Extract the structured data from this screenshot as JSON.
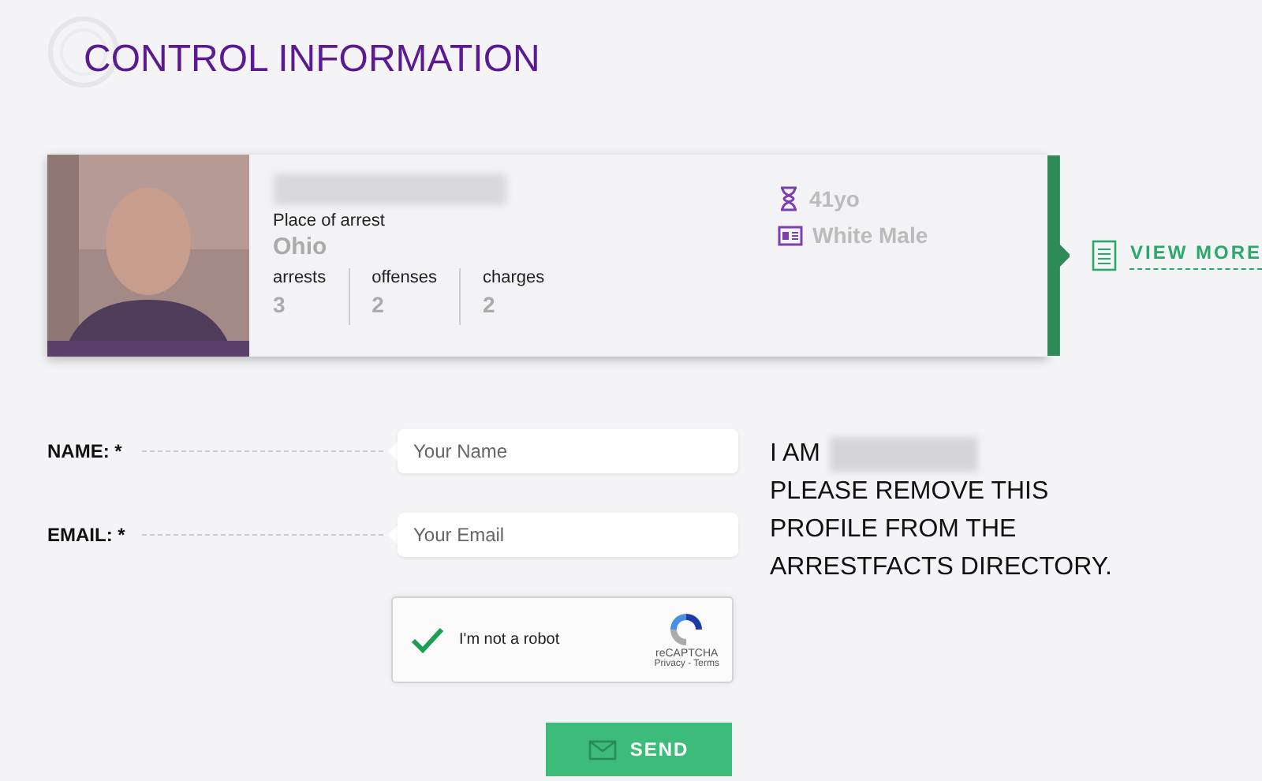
{
  "page": {
    "title": "CONTROL INFORMATION"
  },
  "profile": {
    "kind": "picture",
    "place_label": "Place of arrest",
    "place": "Ohio",
    "stats": [
      {
        "label": "arrests",
        "value": "3"
      },
      {
        "label": "offenses",
        "value": "2"
      },
      {
        "label": "charges",
        "value": "2"
      }
    ],
    "age": "41yo",
    "race_gender": "White Male",
    "view_more": "VIEW MORE"
  },
  "form": {
    "fields": [
      {
        "label": "NAME: *",
        "placeholder": "Your Name"
      },
      {
        "label": "EMAIL: *",
        "placeholder": "Your Email"
      }
    ],
    "captcha": {
      "checked": true,
      "label": "I'm not a robot",
      "brand": "reCAPTCHA",
      "links": "Privacy - Terms"
    },
    "submit": "SEND"
  },
  "statement": {
    "intro": "I AM",
    "text": "PLEASE REMOVE THIS PROFILE FROM THE ARRESTFACTS DIRECTORY."
  }
}
